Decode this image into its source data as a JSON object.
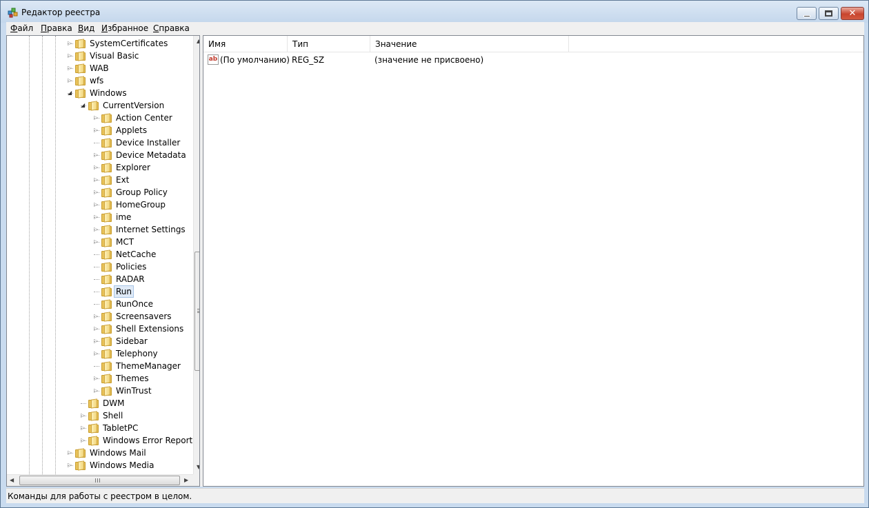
{
  "window": {
    "title": "Редактор реестра"
  },
  "menu": [
    {
      "label": "Файл",
      "accel": "Ф",
      "rest": "айл"
    },
    {
      "label": "Правка",
      "accel": "П",
      "rest": "равка"
    },
    {
      "label": "Вид",
      "accel": "В",
      "rest": "ид"
    },
    {
      "label": "Избранное",
      "accel": "И",
      "rest": "збранное"
    },
    {
      "label": "Справка",
      "accel": "С",
      "rest": "правка"
    }
  ],
  "tree": {
    "items": [
      {
        "label": "SystemCertificates",
        "level": 0,
        "expander": "collapsed"
      },
      {
        "label": "Visual Basic",
        "level": 0,
        "expander": "collapsed"
      },
      {
        "label": "WAB",
        "level": 0,
        "expander": "collapsed"
      },
      {
        "label": "wfs",
        "level": 0,
        "expander": "collapsed"
      },
      {
        "label": "Windows",
        "level": 0,
        "expander": "expanded"
      },
      {
        "label": "CurrentVersion",
        "level": 1,
        "expander": "expanded"
      },
      {
        "label": "Action Center",
        "level": 2,
        "expander": "collapsed"
      },
      {
        "label": "Applets",
        "level": 2,
        "expander": "collapsed"
      },
      {
        "label": "Device Installer",
        "level": 2,
        "expander": "none"
      },
      {
        "label": "Device Metadata",
        "level": 2,
        "expander": "collapsed"
      },
      {
        "label": "Explorer",
        "level": 2,
        "expander": "collapsed"
      },
      {
        "label": "Ext",
        "level": 2,
        "expander": "collapsed"
      },
      {
        "label": "Group Policy",
        "level": 2,
        "expander": "collapsed"
      },
      {
        "label": "HomeGroup",
        "level": 2,
        "expander": "collapsed"
      },
      {
        "label": "ime",
        "level": 2,
        "expander": "collapsed"
      },
      {
        "label": "Internet Settings",
        "level": 2,
        "expander": "collapsed"
      },
      {
        "label": "MCT",
        "level": 2,
        "expander": "collapsed"
      },
      {
        "label": "NetCache",
        "level": 2,
        "expander": "none"
      },
      {
        "label": "Policies",
        "level": 2,
        "expander": "none"
      },
      {
        "label": "RADAR",
        "level": 2,
        "expander": "none"
      },
      {
        "label": "Run",
        "level": 2,
        "expander": "none",
        "selected": true
      },
      {
        "label": "RunOnce",
        "level": 2,
        "expander": "none"
      },
      {
        "label": "Screensavers",
        "level": 2,
        "expander": "collapsed"
      },
      {
        "label": "Shell Extensions",
        "level": 2,
        "expander": "collapsed"
      },
      {
        "label": "Sidebar",
        "level": 2,
        "expander": "collapsed"
      },
      {
        "label": "Telephony",
        "level": 2,
        "expander": "collapsed"
      },
      {
        "label": "ThemeManager",
        "level": 2,
        "expander": "none"
      },
      {
        "label": "Themes",
        "level": 2,
        "expander": "collapsed"
      },
      {
        "label": "WinTrust",
        "level": 2,
        "expander": "collapsed"
      },
      {
        "label": "DWM",
        "level": 1,
        "expander": "none"
      },
      {
        "label": "Shell",
        "level": 1,
        "expander": "collapsed"
      },
      {
        "label": "TabletPC",
        "level": 1,
        "expander": "collapsed"
      },
      {
        "label": "Windows Error Reportin",
        "level": 1,
        "expander": "collapsed"
      },
      {
        "label": "Windows Mail",
        "level": 0,
        "expander": "collapsed"
      },
      {
        "label": "Windows Media",
        "level": 0,
        "expander": "collapsed"
      }
    ]
  },
  "list": {
    "columns": [
      "Имя",
      "Тип",
      "Значение"
    ],
    "rows": [
      {
        "icon": "string-value-icon",
        "icon_text": "ab",
        "name": "(По умолчанию)",
        "type": "REG_SZ",
        "value": "(значение не присвоено)"
      }
    ]
  },
  "status": {
    "text": "Команды для работы с реестром в целом."
  },
  "scroll": {
    "vertical_thumb_fraction": 0.27,
    "vertical_position_fraction": 0.5
  },
  "colors": {
    "titlebar": "#c4d7ec",
    "selection": "#dfeaf7",
    "folder": "#e8c25a"
  }
}
